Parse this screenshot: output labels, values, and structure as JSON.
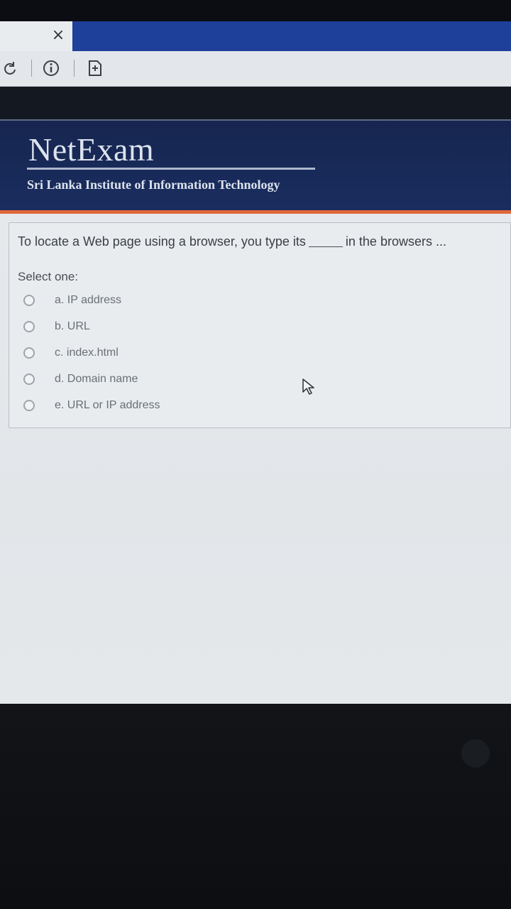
{
  "browser": {
    "tab_close_glyph": "×",
    "toolbar_icons": [
      "refresh-icon",
      "info-icon",
      "reader-icon"
    ]
  },
  "header": {
    "logo_title": "NetExam",
    "institution": "Sri Lanka Institute of Information Technology"
  },
  "question": {
    "text_before": "To locate a Web page using a browser, you type its",
    "text_after": "in the browsers ...",
    "prompt": "Select one:",
    "options": [
      {
        "label": "a. IP address"
      },
      {
        "label": "b. URL"
      },
      {
        "label": "c. index.html"
      },
      {
        "label": "d. Domain name"
      },
      {
        "label": "e. URL or IP address"
      }
    ]
  },
  "colors": {
    "tab_strip": "#1e3f9a",
    "header_bg": "#1a2d5f",
    "accent_rule": "#e0673a"
  }
}
